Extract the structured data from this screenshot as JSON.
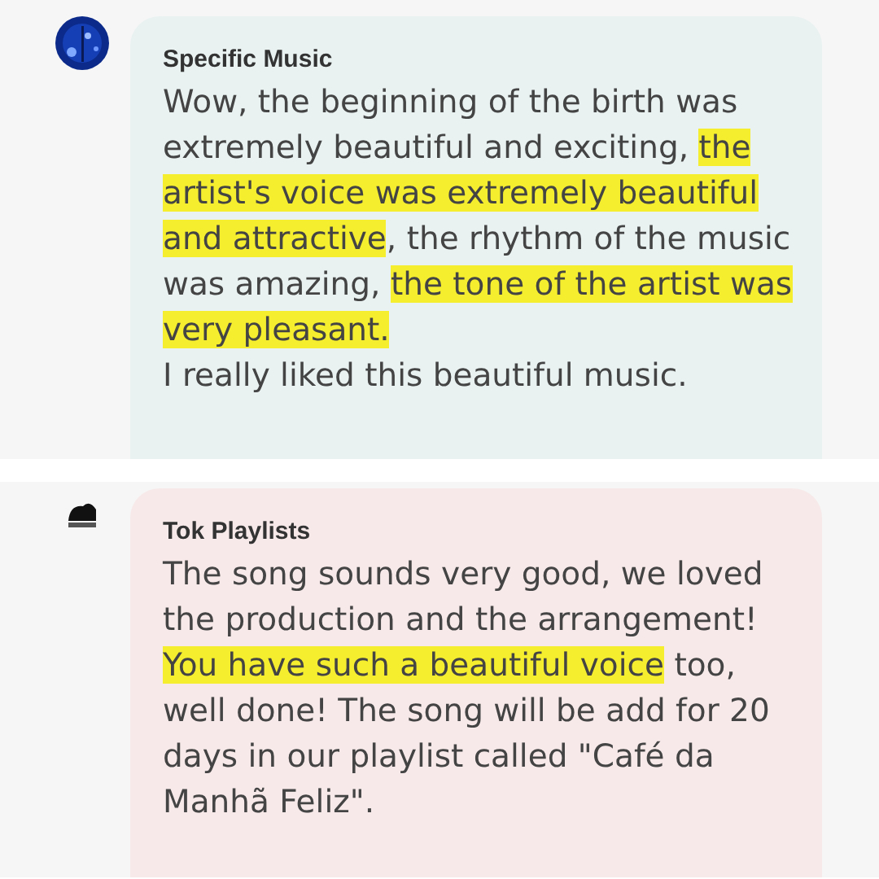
{
  "comments": [
    {
      "author": "Specific Music",
      "color": "#e9f1f1",
      "paragraphs": [
        [
          {
            "text": "Wow, the beginning of the birth was extremely beautiful and exciting, ",
            "highlight": false
          },
          {
            "text": "the artist's voice was extremely beautiful and attractive",
            "highlight": true
          },
          {
            "text": ", the rhythm of the music was amazing, ",
            "highlight": false
          },
          {
            "text": "the tone of the artist was very pleasant.",
            "highlight": true
          }
        ],
        [
          {
            "text": "I really liked this beautiful music.",
            "highlight": false
          }
        ]
      ]
    },
    {
      "author": "Tok Playlists",
      "color": "#f7e9e9",
      "paragraphs": [
        [
          {
            "text": "The song sounds very good, we loved the production and the arrangement! ",
            "highlight": false
          },
          {
            "text": "You have such a beautiful voice",
            "highlight": true
          },
          {
            "text": " too, well done! The song will be add for 20 days in our playlist called \"Café da Manhã Feliz\".",
            "highlight": false
          }
        ]
      ]
    }
  ]
}
